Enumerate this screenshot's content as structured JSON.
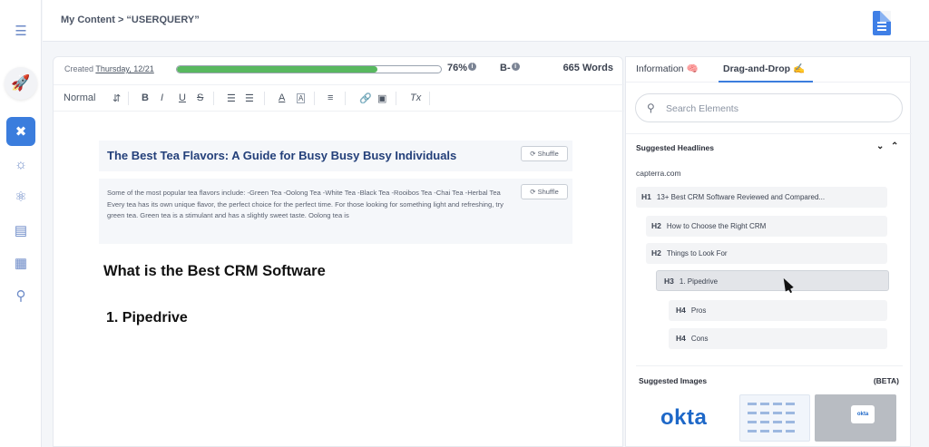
{
  "breadcrumb": "My Content  >  “USERQUERY”",
  "meta": {
    "created_label": "Created",
    "created_date": "Thursday, 12/21",
    "progress_percent": 76,
    "progress_label": "76%",
    "grade": "B-",
    "words": "665 Words"
  },
  "toolbar": {
    "style": "Normal",
    "bold": "B",
    "italic": "I",
    "underline": "U",
    "strike": "S",
    "clear": "Tx"
  },
  "editor": {
    "headline": "The Best Tea Flavors: A Guide for Busy Busy Busy Individuals",
    "shuffle_label": "Shuffle",
    "paragraph": "Some of the most popular tea flavors include: -Green Tea -Oolong Tea -White Tea -Black Tea -Rooibos Tea -Chai Tea -Herbal Tea Every tea has its own unique flavor, the perfect choice for the perfect time. For those looking for something light and refreshing, try green tea. Green tea is a stimulant and has a slightly sweet taste. Oolong tea is",
    "heading_main": "What is the Best CRM Software",
    "heading_sub": "1. Pipedrive"
  },
  "panel": {
    "tab_information": "Information 🧠",
    "tab_dnd": "Drag-and-Drop ✍️",
    "search_placeholder": "Search Elements",
    "suggested_headlines": "Suggested Headlines",
    "source": "capterra.com",
    "headlines": [
      {
        "level": "H1",
        "text": "13+ Best CRM Software Reviewed and Compared..."
      },
      {
        "level": "H2",
        "text": "How to Choose the Right CRM"
      },
      {
        "level": "H2",
        "text": "Things to Look For"
      },
      {
        "level": "H3",
        "text": "1. Pipedrive"
      },
      {
        "level": "H4",
        "text": "Pros"
      },
      {
        "level": "H4",
        "text": "Cons"
      }
    ],
    "suggested_images": "Suggested Images",
    "beta": "(BETA)",
    "okta_logo": "okta"
  },
  "colors": {
    "accent": "#3b7ddd",
    "progress": "#58b85f",
    "headline": "#24407a"
  }
}
